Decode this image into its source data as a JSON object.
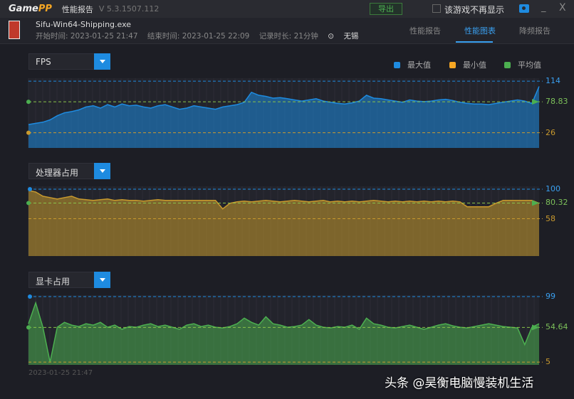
{
  "titlebar": {
    "logo_a": "Game",
    "logo_b": "PP",
    "title": "性能报告",
    "version": "V 5.3.1507.112",
    "export_label": "导出",
    "hide_label": "该游戏不再显示",
    "min_label": "_",
    "close_label": "X"
  },
  "header": {
    "game": "Sifu-Win64-Shipping.exe",
    "start": "开始时间: 2023-01-25 21:47",
    "end": "结束时间: 2023-01-25 22:09",
    "duration": "记录时长: 21分钟",
    "location": "无锡",
    "tabs": [
      {
        "label": "性能报告",
        "active": false
      },
      {
        "label": "性能图表",
        "active": true
      },
      {
        "label": "降频报告",
        "active": false
      }
    ]
  },
  "legend": [
    {
      "label": "最大值",
      "color": "#1e8be0"
    },
    {
      "label": "最小值",
      "color": "#f5a623"
    },
    {
      "label": "平均值",
      "color": "#4caf50"
    }
  ],
  "footer": {
    "timestamp": "2023-01-25 21:47",
    "watermark": "头条 @昊衡电脑慢装机生活"
  },
  "chart_data": [
    {
      "type": "area",
      "selector": "FPS",
      "ylim": [
        0,
        119
      ],
      "max": 114,
      "avg": 78.83,
      "min": 26,
      "max_label": "114",
      "avg_label": "78.83",
      "min_label": "26",
      "color": "#1e8be0",
      "values": [
        40,
        42,
        44,
        48,
        55,
        60,
        62,
        65,
        70,
        72,
        68,
        74,
        70,
        75,
        72,
        73,
        70,
        68,
        72,
        74,
        70,
        66,
        68,
        72,
        70,
        68,
        66,
        70,
        72,
        74,
        78,
        95,
        90,
        88,
        85,
        86,
        84,
        82,
        80,
        82,
        84,
        80,
        78,
        76,
        75,
        77,
        80,
        90,
        85,
        84,
        82,
        80,
        78,
        82,
        80,
        79,
        80,
        82,
        83,
        81,
        78,
        76,
        75,
        75,
        74,
        76,
        78,
        80,
        82,
        80,
        76,
        105
      ]
    },
    {
      "type": "area",
      "selector": "处理器占用",
      "ylim": [
        5,
        104
      ],
      "max": 100,
      "avg": 80.32,
      "min": 58,
      "max_label": "100",
      "avg_label": "80.32",
      "min_label": "58",
      "color": "#c99a2e",
      "values": [
        98,
        96,
        90,
        88,
        86,
        88,
        90,
        86,
        85,
        84,
        85,
        86,
        84,
        85,
        84,
        84,
        83,
        84,
        85,
        84,
        84,
        84,
        84,
        84,
        84,
        84,
        84,
        72,
        80,
        82,
        83,
        82,
        83,
        84,
        83,
        82,
        83,
        84,
        83,
        82,
        83,
        84,
        82,
        83,
        82,
        83,
        82,
        83,
        84,
        83,
        82,
        83,
        82,
        83,
        82,
        83,
        82,
        83,
        82,
        83,
        82,
        75,
        75,
        75,
        75,
        80,
        84,
        84,
        84,
        84,
        84,
        80
      ]
    },
    {
      "type": "area",
      "selector": "显卡占用",
      "ylim": [
        1,
        101
      ],
      "max": 99,
      "avg": 54.64,
      "min": 5,
      "max_label": "99",
      "avg_label": "54.64",
      "min_label": "5",
      "color": "#4caf50",
      "values": [
        60,
        90,
        55,
        5,
        55,
        62,
        58,
        56,
        60,
        58,
        62,
        55,
        58,
        52,
        56,
        55,
        58,
        60,
        56,
        58,
        55,
        52,
        58,
        60,
        56,
        58,
        55,
        54,
        56,
        60,
        68,
        62,
        58,
        70,
        60,
        58,
        55,
        56,
        58,
        66,
        58,
        55,
        54,
        56,
        55,
        58,
        52,
        68,
        60,
        58,
        55,
        54,
        56,
        58,
        55,
        52,
        55,
        58,
        60,
        57,
        55,
        54,
        56,
        58,
        60,
        58,
        56,
        55,
        54,
        30,
        55,
        60
      ]
    }
  ]
}
